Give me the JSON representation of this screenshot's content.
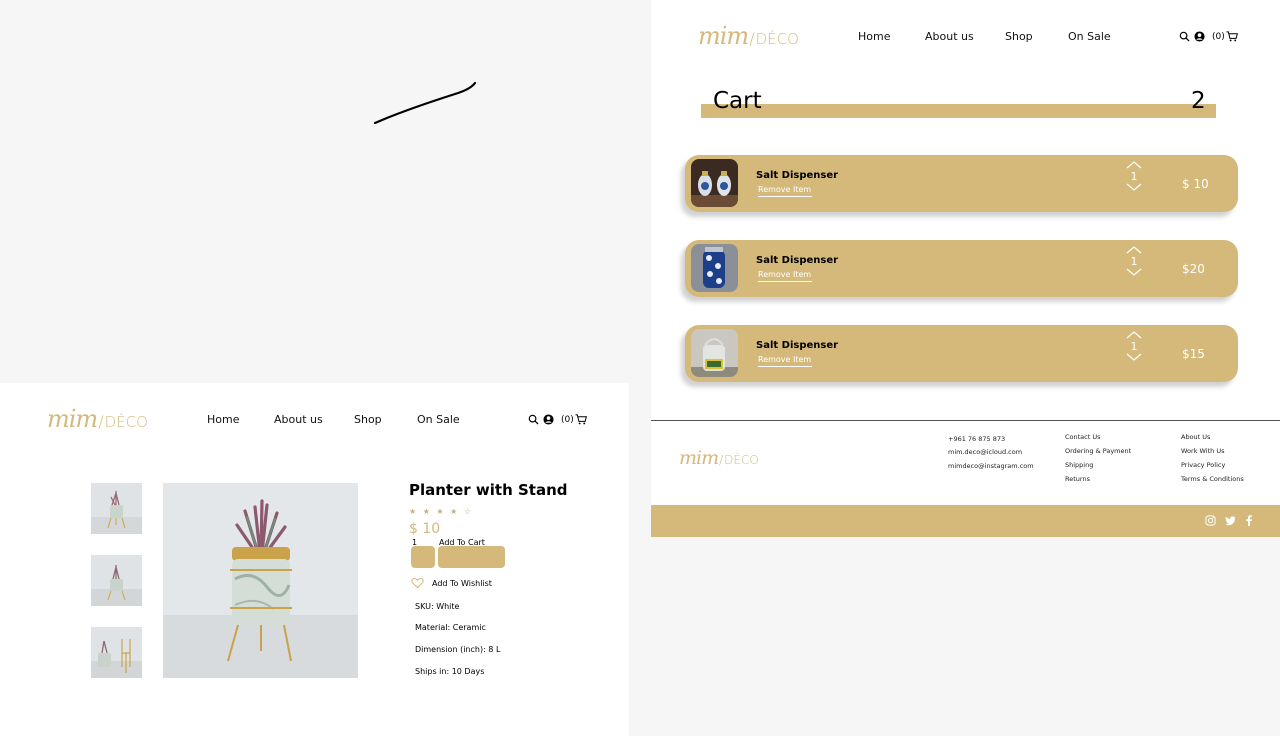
{
  "brand": {
    "mim": "mim",
    "slash": "/",
    "deco": "DÉCO"
  },
  "nav": {
    "home": "Home",
    "about": "About us",
    "shop": "Shop",
    "sale": "On Sale"
  },
  "header_icons": {
    "search": "search-icon",
    "account": "user-icon",
    "cart_count": "(0)",
    "cart": "cart-icon"
  },
  "cart": {
    "title": "Cart",
    "count": "2",
    "items": [
      {
        "name": "Salt Dispenser",
        "remove": "Remove Item",
        "qty": "1",
        "price": "$ 10"
      },
      {
        "name": "Salt Dispenser",
        "remove": "Remove Item",
        "qty": "1",
        "price": "$20"
      },
      {
        "name": "Salt Dispenser",
        "remove": "Remove Item",
        "qty": "1",
        "price": "$15"
      }
    ]
  },
  "footer": {
    "contact": [
      "+961 76 875 873",
      "mim.deco@icloud.com",
      "mimdeco@instagram.com"
    ],
    "help": [
      "Contact Us",
      "Ordering & Payment",
      "Shipping",
      "Returns"
    ],
    "company": [
      "About Us",
      "Work With Us",
      "Privacy Policy",
      "Terms & Conditions"
    ],
    "social": [
      "instagram-icon",
      "twitter-icon",
      "facebook-icon"
    ]
  },
  "product": {
    "title": "Planter with Stand",
    "rating": "★ ★ ★ ★ ☆",
    "price": "$ 10",
    "qty": "1",
    "add_to_cart": "Add To Cart",
    "wishlist": "Add To Wishlist",
    "sku": "SKU: White",
    "material": "Material: Ceramic",
    "dimension": "Dimension (inch): 8 L",
    "ships": "Ships in: 10 Days"
  },
  "colors": {
    "accent": "#d4b97a",
    "panel_bg": "#ffffff",
    "page_bg": "#f6f6f6"
  }
}
